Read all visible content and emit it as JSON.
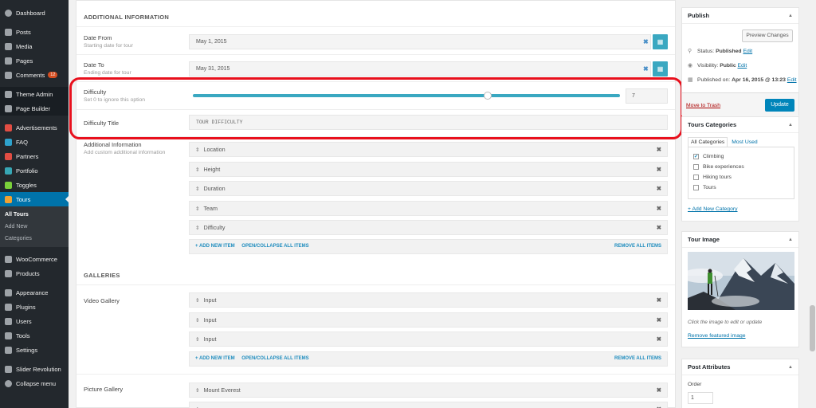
{
  "sidebar": {
    "items": [
      {
        "label": "Dashboard",
        "icon": "dashboard-icon"
      },
      {
        "label": "Posts",
        "icon": "pin-icon"
      },
      {
        "label": "Media",
        "icon": "media-icon"
      },
      {
        "label": "Pages",
        "icon": "pages-icon"
      },
      {
        "label": "Comments",
        "icon": "comments-icon",
        "badge": "12"
      },
      {
        "label": "Theme Admin",
        "icon": "theme-admin-icon"
      },
      {
        "label": "Page Builder",
        "icon": "page-builder-icon"
      },
      {
        "label": "Advertisements",
        "icon": "advertisements-icon"
      },
      {
        "label": "FAQ",
        "icon": "faq-icon"
      },
      {
        "label": "Partners",
        "icon": "partners-icon"
      },
      {
        "label": "Portfolio",
        "icon": "portfolio-icon"
      },
      {
        "label": "Toggles",
        "icon": "toggles-icon"
      },
      {
        "label": "Tours",
        "icon": "tours-icon"
      },
      {
        "label": "WooCommerce",
        "icon": "woocommerce-icon"
      },
      {
        "label": "Products",
        "icon": "products-icon"
      },
      {
        "label": "Appearance",
        "icon": "appearance-icon"
      },
      {
        "label": "Plugins",
        "icon": "plugins-icon"
      },
      {
        "label": "Users",
        "icon": "users-icon"
      },
      {
        "label": "Tools",
        "icon": "tools-icon"
      },
      {
        "label": "Settings",
        "icon": "settings-icon"
      },
      {
        "label": "Slider Revolution",
        "icon": "slider-revolution-icon"
      },
      {
        "label": "Collapse menu",
        "icon": "collapse-icon"
      }
    ],
    "tours_submenu": [
      "All Tours",
      "Add New",
      "Categories"
    ]
  },
  "additional_info": {
    "heading": "ADDITIONAL INFORMATION",
    "date_from": {
      "label": "Date From",
      "desc": "Starting date for tour",
      "value": "May 1, 2015"
    },
    "date_to": {
      "label": "Date To",
      "desc": "Ending date for tour",
      "value": "May 31, 2015"
    },
    "difficulty": {
      "label": "Difficulty",
      "desc": "Set 0 to ignore this option",
      "value": "7",
      "slider_fraction": 0.69
    },
    "difficulty_title": {
      "label": "Difficulty Title",
      "value": "TOUR DIFFICULTY"
    },
    "custom": {
      "label": "Additional Information",
      "desc": "Add custom additional information",
      "items": [
        "Location",
        "Height",
        "Duration",
        "Team",
        "Difficulty"
      ]
    }
  },
  "list_actions": {
    "add": "+ ADD NEW ITEM",
    "toggle": "OPEN/COLLAPSE ALL ITEMS",
    "remove": "REMOVE ALL ITEMS"
  },
  "galleries": {
    "heading": "GALLERIES",
    "video": {
      "label": "Video Gallery",
      "items": [
        "Input",
        "Input",
        "Input"
      ]
    },
    "picture": {
      "label": "Picture Gallery",
      "items": [
        "Mount Everest"
      ]
    }
  },
  "publish": {
    "title": "Publish",
    "preview": "Preview Changes",
    "status_label": "Status:",
    "status_value": "Published",
    "visibility_label": "Visibility:",
    "visibility_value": "Public",
    "published_label": "Published on:",
    "published_value": "Apr 16, 2015 @ 13:23",
    "edit": "Edit",
    "trash": "Move to Trash",
    "update": "Update"
  },
  "categories": {
    "title": "Tours Categories",
    "tab_all": "All Categories",
    "tab_used": "Most Used",
    "items": [
      {
        "label": "Climbing",
        "checked": true
      },
      {
        "label": "Bike experiences",
        "checked": false
      },
      {
        "label": "Hiking tours",
        "checked": false
      },
      {
        "label": "Tours",
        "checked": false
      }
    ],
    "add_new": "+ Add New Category"
  },
  "tour_image": {
    "title": "Tour Image",
    "caption": "Click the image to edit or update",
    "remove": "Remove featured image"
  },
  "post_attributes": {
    "title": "Post Attributes",
    "order_label": "Order",
    "order_value": "1"
  },
  "colors": {
    "accent": "#3aa8c1",
    "highlight": "#e8101d",
    "wp_blue": "#0073aa"
  }
}
